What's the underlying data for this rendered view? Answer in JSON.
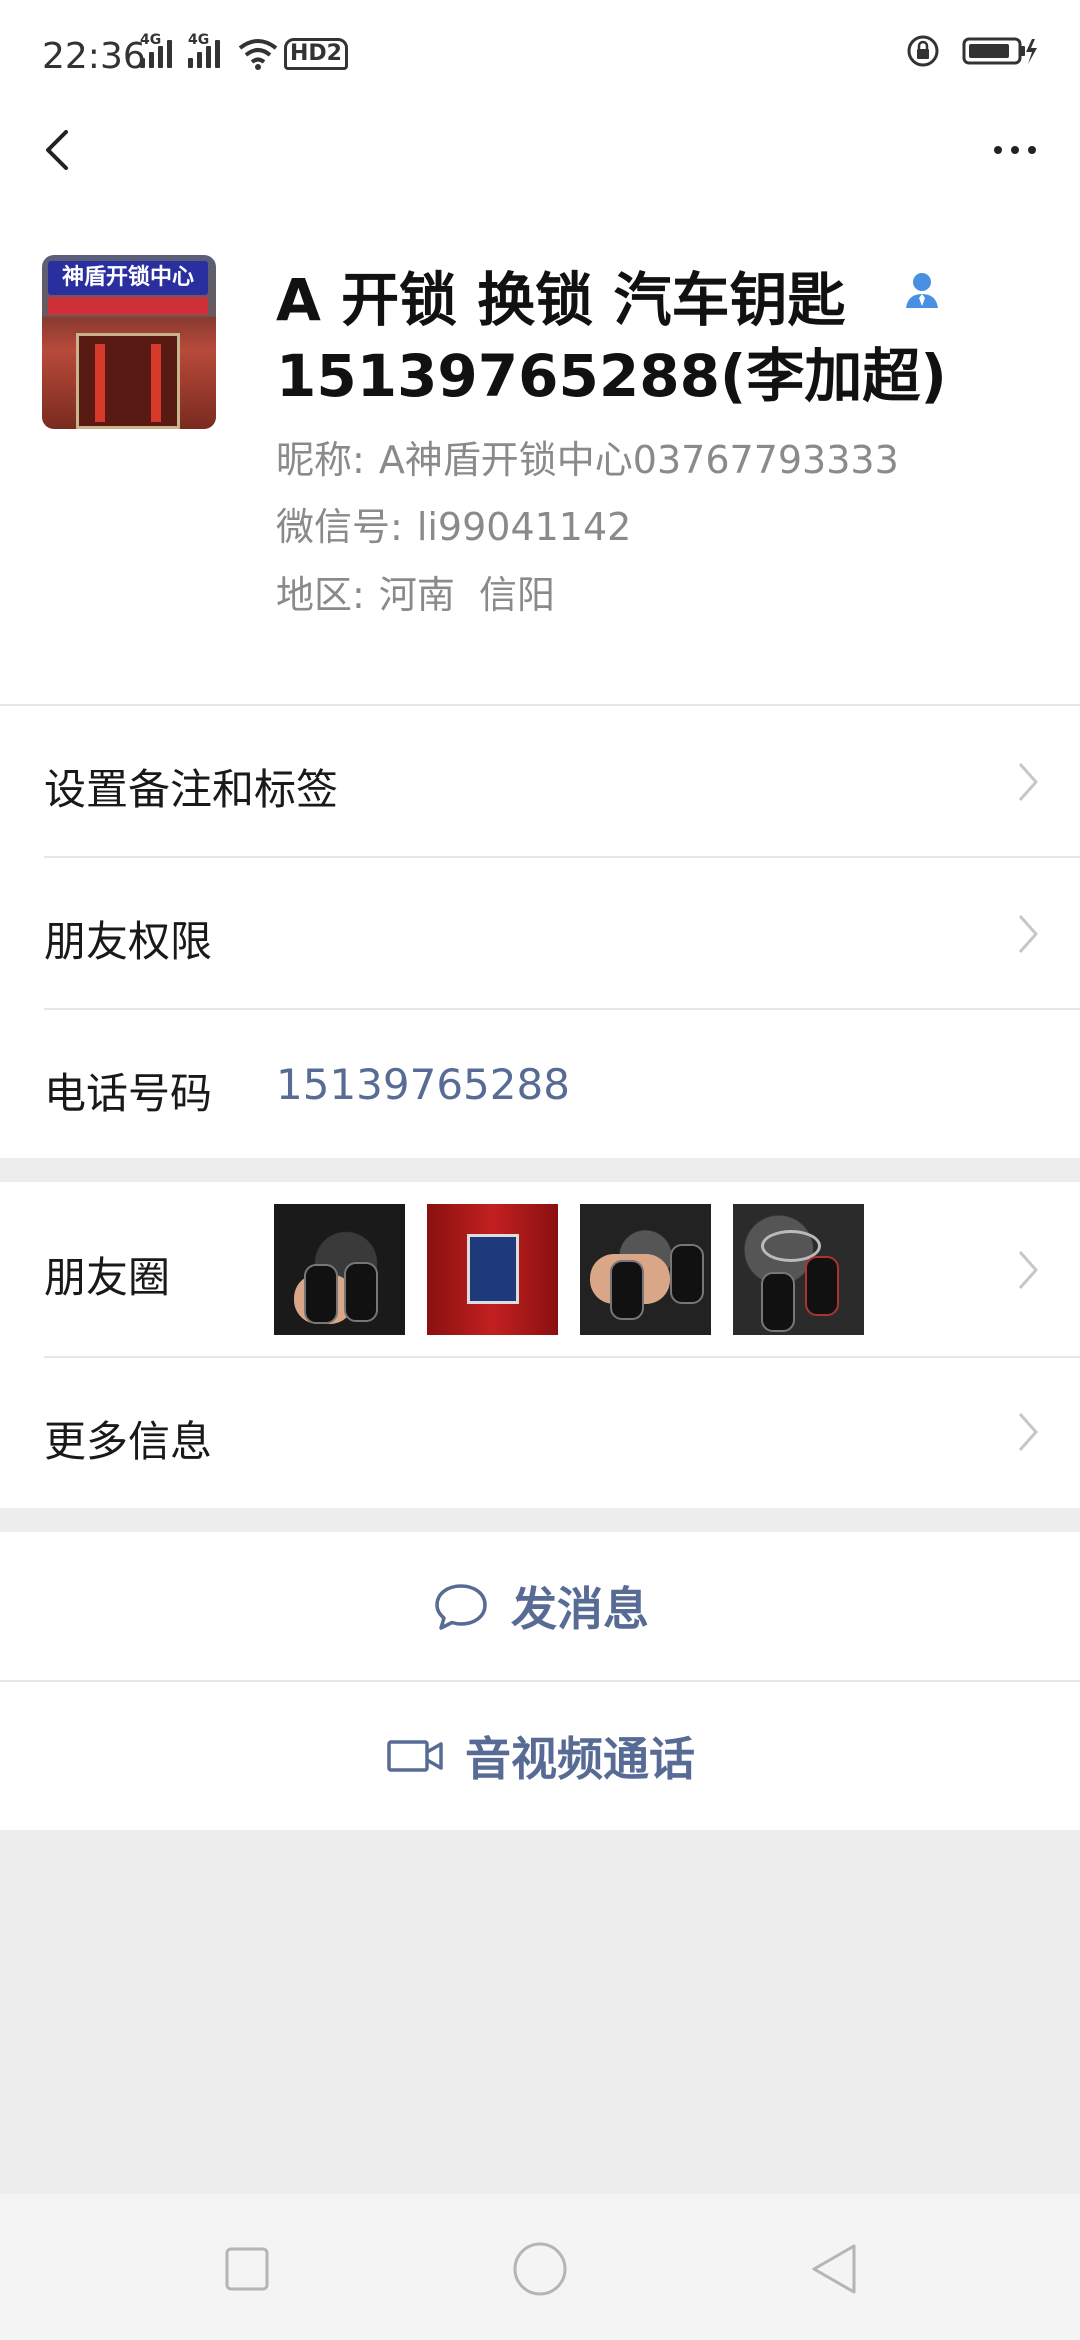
{
  "status_bar": {
    "time": "22:36",
    "network_1": "4G",
    "network_2": "4G",
    "hd_badge": "HD2"
  },
  "profile": {
    "name_line_1": "A 开锁 换锁 汽车钥匙",
    "name_line_2": "15139765288(李加超)",
    "nickname_label": "昵称:",
    "nickname": "A神盾开锁中心03767793333",
    "wechat_id_label": "微信号:",
    "wechat_id": "li99041142",
    "region_label": "地区:",
    "region": "河南  信阳",
    "avatar_sign_text": "神盾开锁中心"
  },
  "menu": {
    "remark_tags": "设置备注和标签",
    "friend_permissions": "朋友权限",
    "phone_label": "电话号码",
    "phone_value": "15139765288",
    "moments": "朋友圈",
    "more_info": "更多信息"
  },
  "actions": {
    "send_message": "发消息",
    "video_call": "音视频通话"
  },
  "colors": {
    "link_blue": "#576b95",
    "background": "#ededed",
    "card": "#ffffff",
    "contact_icon": "#4a90e2"
  }
}
